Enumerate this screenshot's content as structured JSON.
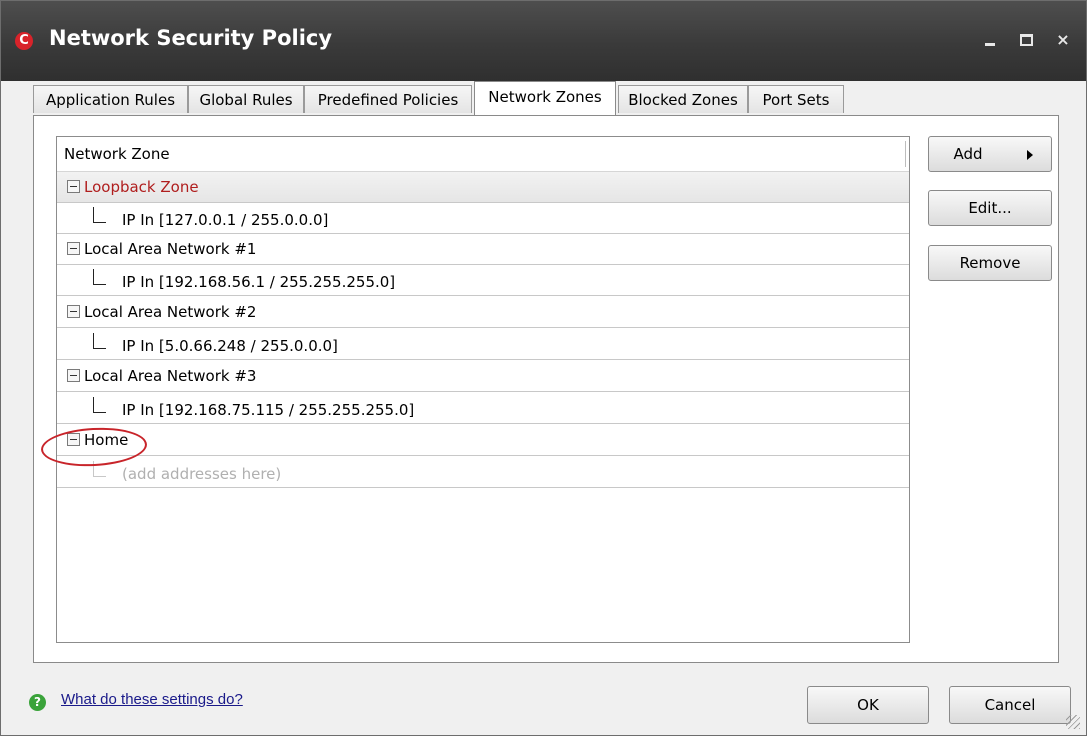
{
  "window": {
    "title": "Network Security Policy",
    "app_icon_letter": "C",
    "controls": {
      "minimize": "minimize-icon",
      "maximize": "maximize-icon",
      "close": "×"
    }
  },
  "tabs": [
    {
      "label": "Application Rules",
      "active": false
    },
    {
      "label": "Global Rules",
      "active": false
    },
    {
      "label": "Predefined Policies",
      "active": false
    },
    {
      "label": "Network Zones",
      "active": true
    },
    {
      "label": "Blocked Zones",
      "active": false
    },
    {
      "label": "Port Sets",
      "active": false
    }
  ],
  "list": {
    "header": "Network Zone",
    "rows": [
      {
        "type": "zone",
        "label": "Loopback Zone",
        "selected": true,
        "color": "#b01e1e"
      },
      {
        "type": "address",
        "label": "IP In [127.0.0.1 / 255.0.0.0]"
      },
      {
        "type": "zone",
        "label": "Local Area Network #1"
      },
      {
        "type": "address",
        "label": "IP In [192.168.56.1 / 255.255.255.0]"
      },
      {
        "type": "zone",
        "label": "Local Area Network #2"
      },
      {
        "type": "address",
        "label": "IP In [5.0.66.248 / 255.0.0.0]"
      },
      {
        "type": "zone",
        "label": "Local Area Network #3"
      },
      {
        "type": "address",
        "label": "IP In [192.168.75.115 / 255.255.255.0]"
      },
      {
        "type": "zone",
        "label": "Home"
      },
      {
        "type": "address",
        "label": "(add addresses here)",
        "placeholder": true
      }
    ]
  },
  "side_buttons": {
    "add": "Add",
    "edit": "Edit...",
    "remove": "Remove"
  },
  "footer": {
    "help_icon": "?",
    "help_link": "What do these settings do?",
    "ok": "OK",
    "cancel": "Cancel"
  },
  "colors": {
    "titlebar": "#3a3a3a",
    "annotation": "#c8242a",
    "zone_selected_text": "#b01e1e"
  }
}
